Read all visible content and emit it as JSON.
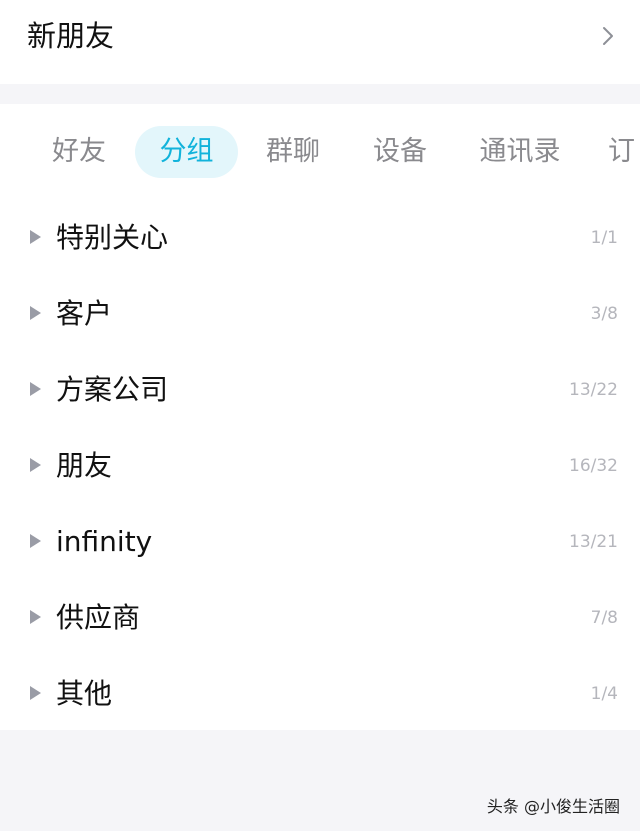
{
  "new_friends": {
    "label": "新朋友"
  },
  "tabs": [
    {
      "label": "好友"
    },
    {
      "label": "分组"
    },
    {
      "label": "群聊"
    },
    {
      "label": "设备"
    },
    {
      "label": "通讯录"
    },
    {
      "label": "订"
    }
  ],
  "groups": [
    {
      "name": "特别关心",
      "count": "1/1"
    },
    {
      "name": "客户",
      "count": "3/8"
    },
    {
      "name": "方案公司",
      "count": "13/22"
    },
    {
      "name": "朋友",
      "count": "16/32"
    },
    {
      "name": "infinity",
      "count": "13/21"
    },
    {
      "name": "供应商",
      "count": "7/8"
    },
    {
      "name": "其他",
      "count": "1/4"
    }
  ],
  "watermark": "头条 @小俊生活圈",
  "colors": {
    "accent": "#11b3db",
    "accent_bg": "#e3f6fb",
    "muted": "#8a8a8e"
  }
}
